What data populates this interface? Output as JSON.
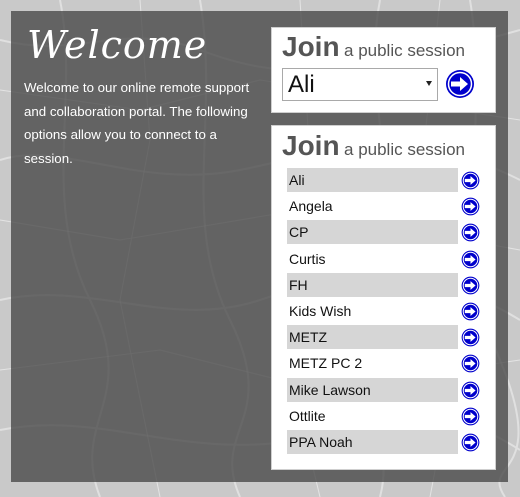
{
  "welcome": {
    "title": "Welcome",
    "text": "Welcome to our online remote support and collaboration portal. The following options allow you to connect to a session."
  },
  "join_select": {
    "heading_big": "Join",
    "heading_small": "a public session",
    "selected_value": "Ali",
    "go_icon": "arrow-right-circle-icon"
  },
  "join_list": {
    "heading_big": "Join",
    "heading_small": "a public session",
    "go_icon": "arrow-right-circle-icon",
    "sessions": [
      "Ali",
      "Angela",
      "CP",
      "Curtis",
      "FH",
      "Kids Wish",
      "METZ",
      "METZ PC 2",
      "Mike Lawson",
      "Ottlite",
      "PPA Noah"
    ]
  },
  "colors": {
    "accent": "#0000cc",
    "panel": "#464646",
    "row_shade": "#d6d6d6"
  }
}
